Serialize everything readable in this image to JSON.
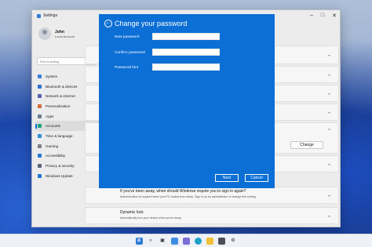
{
  "window": {
    "title": "Settings"
  },
  "user": {
    "name": "John",
    "account_type": "Local Account"
  },
  "search": {
    "placeholder": "Find a setting"
  },
  "sidebar": {
    "items": [
      {
        "label": "System",
        "icon": "monitor-icon",
        "color": "#3c7fd8"
      },
      {
        "label": "Bluetooth & devices",
        "icon": "bluetooth-icon",
        "color": "#2f6fd0"
      },
      {
        "label": "Network & internet",
        "icon": "wifi-icon",
        "color": "#5a5fb0"
      },
      {
        "label": "Personalization",
        "icon": "brush-icon",
        "color": "#d06b3a"
      },
      {
        "label": "Apps",
        "icon": "apps-icon",
        "color": "#6b7b90"
      },
      {
        "label": "Accounts",
        "icon": "person-icon",
        "color": "#1fa37a"
      },
      {
        "label": "Time & language",
        "icon": "clock-icon",
        "color": "#2b8fd6"
      },
      {
        "label": "Gaming",
        "icon": "controller-icon",
        "color": "#7a7f88"
      },
      {
        "label": "Accessibility",
        "icon": "accessibility-icon",
        "color": "#2776d3"
      },
      {
        "label": "Privacy & security",
        "icon": "shield-icon",
        "color": "#5b6675"
      },
      {
        "label": "Windows Update",
        "icon": "update-icon",
        "color": "#1b76d6"
      }
    ],
    "active_index": 5
  },
  "content": {
    "change_button": "Change",
    "away_title": "If you've been away, when should Windows require you to sign in again?",
    "away_desc": "Authentication is required when your PC wakes from sleep. Sign in as an administrator to change this setting.",
    "dynamic_title": "Dynamic lock",
    "dynamic_desc": "Automatically lock your device when you're away"
  },
  "dialog": {
    "title": "Change your password",
    "fields": [
      {
        "label": "New password",
        "value": ""
      },
      {
        "label": "Confirm password",
        "value": ""
      },
      {
        "label": "Password hint",
        "value": ""
      }
    ],
    "next_button": "Next",
    "cancel_button": "Cancel"
  },
  "taskbar": {
    "icons": [
      "start-icon",
      "search-icon",
      "task-view-icon",
      "widgets-icon",
      "chat-icon",
      "edge-icon",
      "file-explorer-icon",
      "store-icon",
      "settings-icon"
    ]
  },
  "colors": {
    "dialog_bg": "#0b6fd6",
    "accent": "#1570d9"
  }
}
